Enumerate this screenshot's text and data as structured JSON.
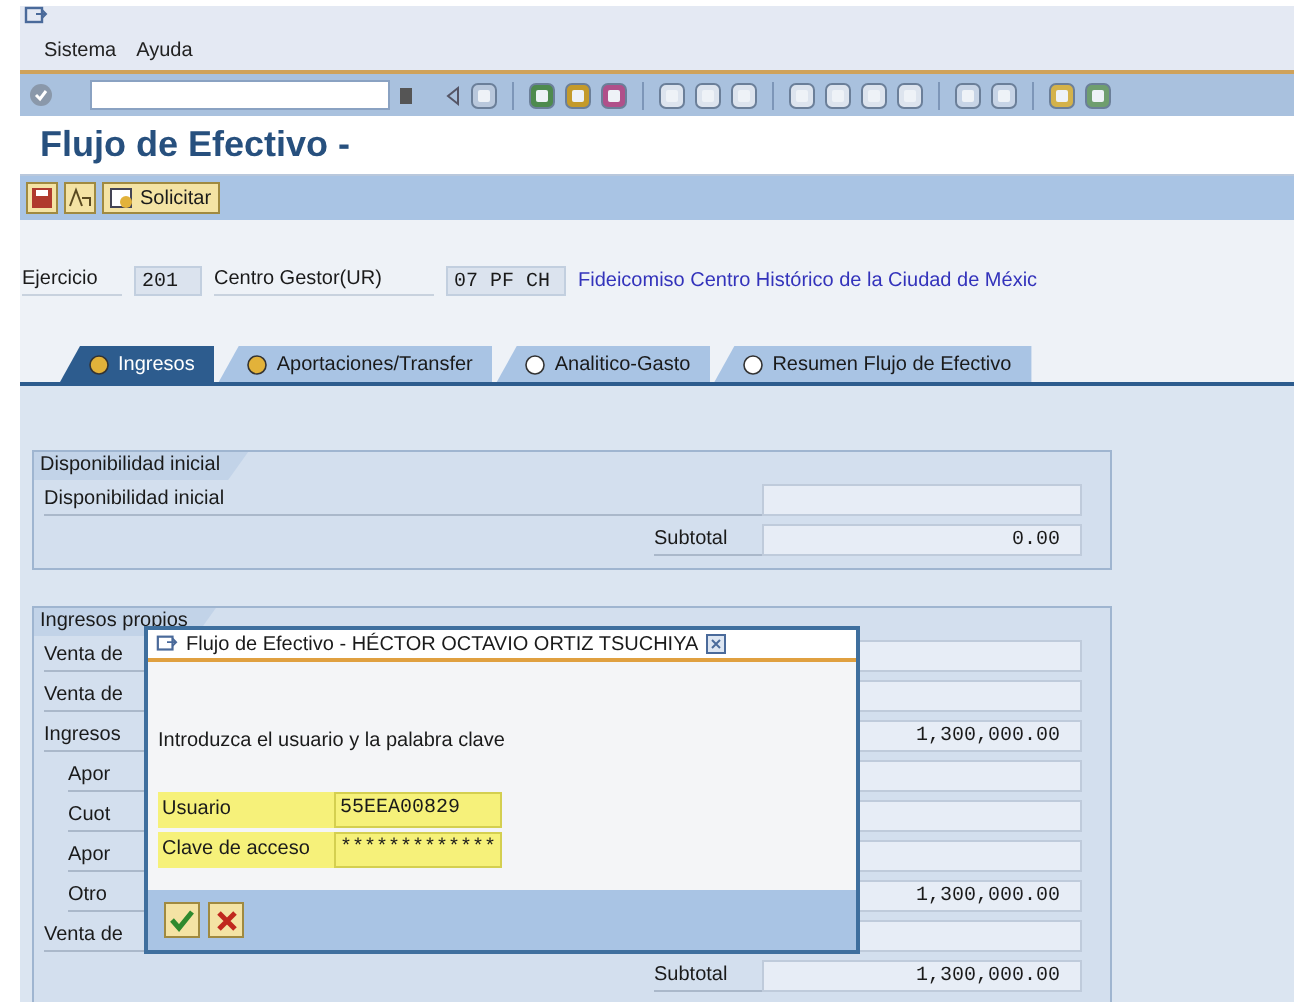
{
  "menu": [
    "Sistema",
    "Ayuda"
  ],
  "title": "Flujo de Efectivo -",
  "app_toolbar": {
    "button": "Solicitar"
  },
  "header_fields": [
    {
      "label": "Ejercicio",
      "value": "201"
    },
    {
      "label": "Centro Gestor(UR)",
      "value": "07 PF CH",
      "description": "Fideicomiso Centro Histórico de la Ciudad de Méxic"
    }
  ],
  "tabs": [
    {
      "label": "Ingresos",
      "selected": true
    },
    {
      "label": "Aportaciones/Transfer",
      "selected": false
    },
    {
      "label": "Analitico-Gasto",
      "selected": false
    },
    {
      "label": "Resumen Flujo de Efectivo",
      "selected": false
    }
  ],
  "groups": [
    {
      "title": "Disponibilidad inicial",
      "rows": [
        {
          "label": "Disponibilidad inicial",
          "indent": false,
          "value": ""
        },
        {
          "label": "Subtotal",
          "kind": "subtotal",
          "value": "0.00"
        }
      ]
    },
    {
      "title": "Ingresos propios",
      "rows": [
        {
          "label": "Venta de",
          "indent": false,
          "value": ""
        },
        {
          "label": "Venta de",
          "indent": false,
          "value": ""
        },
        {
          "label": "Ingresos",
          "indent": false,
          "value": "1,300,000.00"
        },
        {
          "label": "Apor",
          "indent": true,
          "value": ""
        },
        {
          "label": "Cuot",
          "indent": true,
          "value": ""
        },
        {
          "label": "Apor",
          "indent": true,
          "value": ""
        },
        {
          "label": "Otro",
          "indent": true,
          "value": "1,300,000.00"
        },
        {
          "label": "Venta de",
          "indent": false,
          "value": ""
        },
        {
          "label": "Subtotal",
          "kind": "subtotal",
          "value": "1,300,000.00"
        }
      ]
    }
  ],
  "dialog": {
    "title": "Flujo de Efectivo - HÉCTOR OCTAVIO ORTIZ TSUCHIYA",
    "message": "Introduzca el usuario y la palabra clave",
    "fields": [
      {
        "label": "Usuario",
        "value": "55EEA00829"
      },
      {
        "label": "Clave de acceso",
        "value": "*************"
      }
    ]
  }
}
